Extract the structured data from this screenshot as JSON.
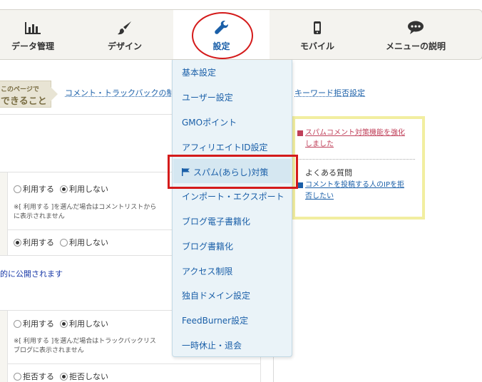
{
  "nav": {
    "items": [
      {
        "label": "データ管理",
        "icon": "bar-chart-icon"
      },
      {
        "label": "デザイン",
        "icon": "paintbrush-icon"
      },
      {
        "label": "設定",
        "icon": "wrench-icon"
      },
      {
        "label": "モバイル",
        "icon": "mobile-phone-icon"
      },
      {
        "label": "メニューの説明",
        "icon": "speech-bubble-icon"
      }
    ],
    "active_index": 2
  },
  "page_badge": {
    "line1": "このページで",
    "line2": "できること"
  },
  "links": {
    "comment_trackback": "コメント・トラックバックの制",
    "keyword_block": "キーワード拒否設定"
  },
  "dropdown": {
    "items": [
      "基本設定",
      "ユーザー設定",
      "GMOポイント",
      "アフィリエイトID設定",
      "スパム(あらし)対策",
      "インポート・エクスポート",
      "ブログ電子書籍化",
      "ブログ書籍化",
      "アクセス制限",
      "独自ドメイン設定",
      "FeedBurner設定",
      "一時休止・退会"
    ],
    "highlighted_index": 4,
    "highlight_icon": "flag-icon"
  },
  "infobox": {
    "news_line1": "スパムコメント対策機能を強化",
    "news_line2": "しました",
    "faq_heading": "よくある質問",
    "faq_line1": "コメントを投稿する人のIPを拒",
    "faq_line2": "否したい"
  },
  "settings": {
    "use": "利用する",
    "not_use": "利用しない",
    "reject": "拒否する",
    "not_reject": "拒否しない",
    "note1_line1": "※[ 利用する ]を選んだ場合はコメントリストから",
    "note1_line2": "に表示されません",
    "public_text": "的に公開されます",
    "note2_line1": "※[ 利用する ]を選んだ場合はトラックバックリス",
    "note2_line2": "ブログに表示されません"
  },
  "colors": {
    "accent": "#1a5fa8",
    "highlight_red": "#d41b1b",
    "infobox_border": "#f2eea0",
    "dropdown_bg": "#eaf3f8"
  }
}
